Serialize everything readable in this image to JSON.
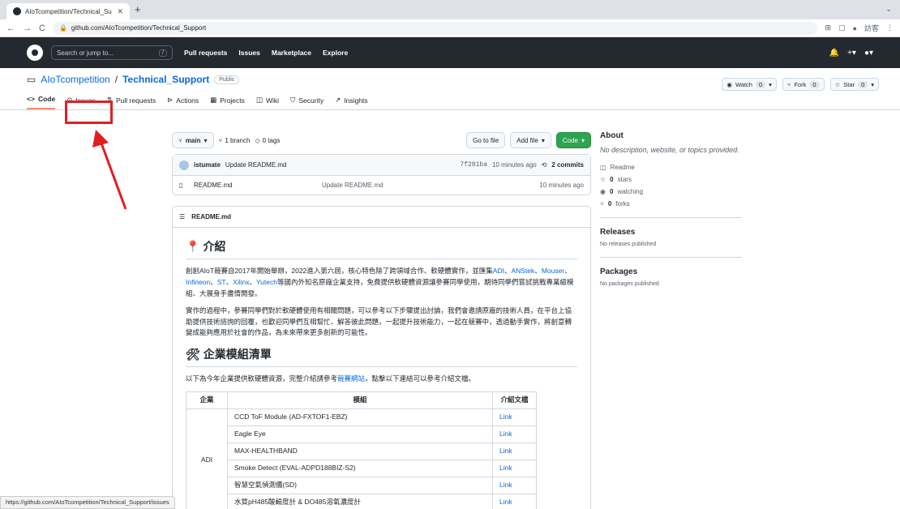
{
  "browser": {
    "tab_title": "AIoTcompetition/Technical_Su",
    "url": "github.com/AIoTcompetition/Technical_Support",
    "profile": "訪客"
  },
  "github": {
    "search_placeholder": "Search or jump to...",
    "slash": "/",
    "nav": [
      "Pull requests",
      "Issues",
      "Marketplace",
      "Explore"
    ]
  },
  "repo": {
    "owner": "AIoTcompetition",
    "sep": "/",
    "name": "Technical_Support",
    "visibility": "Public",
    "watch": "Watch",
    "watch_count": "0",
    "fork": "Fork",
    "fork_count": "0",
    "star": "Star",
    "star_count": "0"
  },
  "tabs": [
    "Code",
    "Issues",
    "Pull requests",
    "Actions",
    "Projects",
    "Wiki",
    "Security",
    "Insights"
  ],
  "toolbar": {
    "branch": "main",
    "branches": "1 branch",
    "tags": "0 tags",
    "go_to_file": "Go to file",
    "add_file": "Add file",
    "code": "Code"
  },
  "commit": {
    "author": "istumate",
    "message": "Update README.md",
    "hash": "7f281ba",
    "time": "10 minutes ago",
    "count": "2 commits"
  },
  "file": {
    "name": "README.md",
    "message": "Update README.md",
    "time": "10 minutes ago"
  },
  "readme": {
    "header": "README.md",
    "h1": "介紹",
    "p1a": "創創AIoT競賽自2017年開始舉辦，2022進入第六屆，核心特色除了跨領域合作、軟硬體實作，並匯集",
    "l1": "ADI",
    "c1": "、",
    "l2": "ANStek",
    "c2": "、",
    "l3": "Mouser",
    "c3": "、",
    "l4": "Infineon",
    "c4": "、",
    "l5": "ST",
    "c5": "、",
    "l6": "Xilinx",
    "c6": "、",
    "l7": "Yutech",
    "p1b": "等國內外知名原廠企業支持，免費提供軟硬體資源讓參賽同學使用，期待同學們嘗試挑戰專業級模組、大展身手盡情開發。",
    "p2": "實作的過程中，參賽同學們對於軟硬體使用有相關問題，可以參考以下步驟提出討論，我們會邀請原廠的技術人員，在平台上協助提供技術諮詢的回覆，也歡迎同學們互相幫忙、解答彼此問題，一起提升技術能力，一起在競賽中，透過動手實作，將創意轉變成能夠應用於社會的作品，為未來帶來更多創新的可能性。",
    "h2": "企業模組清單",
    "p3a": "以下為今年企業提供軟硬體資源，完整介紹請參考",
    "p3link": "競賽網站",
    "p3b": "，點擊以下連結可以參考介紹文檔。",
    "table": {
      "headers": [
        "企業",
        "模組",
        "介紹文檔"
      ],
      "company": "ADI",
      "rows": [
        [
          "CCD ToF Module (AD-FXTOF1-EBZ)",
          "Link"
        ],
        [
          "Eagle Eye",
          "Link"
        ],
        [
          "MAX-HEALTHBAND",
          "Link"
        ],
        [
          "Smoke Detect (EVAL-ADPD188BIZ-S2)",
          "Link"
        ],
        [
          "智慧空氣偵測儀(SD)",
          "Link"
        ],
        [
          "水質pH485酸鹼度計 & DO485溶氧濃度計",
          "Link"
        ]
      ]
    }
  },
  "about": {
    "title": "About",
    "desc": "No description, website, or topics provided.",
    "readme": "Readme",
    "stars": "0",
    "stars_l": "stars",
    "watching": "0",
    "watching_l": "watching",
    "forks": "0",
    "forks_l": "forks",
    "releases": "Releases",
    "releases_none": "No releases published",
    "packages": "Packages",
    "packages_none": "No packages published"
  },
  "status_url": "https://github.com/AIoTcompetition/Technical_Support/issues",
  "colors": {
    "accent": "#0969da",
    "highlight": "#e02020",
    "green": "#2da44e"
  }
}
